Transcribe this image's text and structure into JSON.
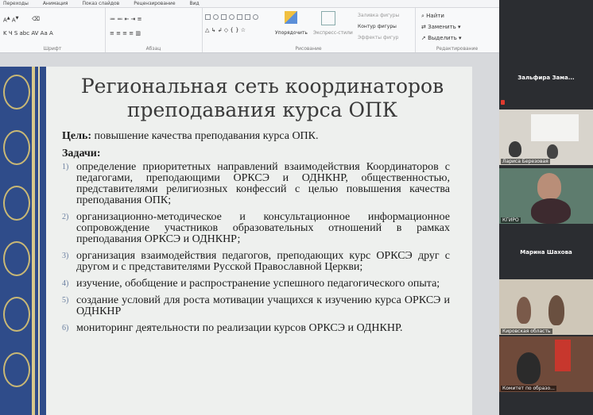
{
  "ribbon_tabs": [
    "Переходы",
    "Анимация",
    "Показ слайдов",
    "Рецензирование",
    "Вид"
  ],
  "ribbon": {
    "group_font": "Шрифт",
    "group_paragraph": "Абзац",
    "group_drawing": "Рисование",
    "group_editing": "Редактирование",
    "arrange": "Упорядочить",
    "express_styles": "Экспресс-стили",
    "shape_fill": "Заливка фигуры",
    "shape_outline": "Контур фигуры",
    "shape_effects": "Эффекты фигур",
    "find": "Найти",
    "replace": "Заменить",
    "select": "Выделить"
  },
  "slide": {
    "title_line1": "Региональная сеть координаторов",
    "title_line2": "преподавания курса ОПК",
    "goal_label": "Цель:",
    "goal_text": " повышение качества преподавания курса ОПК.",
    "tasks_label": "Задачи:",
    "tasks": [
      {
        "num": "1)",
        "text": "определение приоритетных направлений взаимодействия Координаторов с педагогами, преподающими ОРКСЭ и ОДНКНР, общественностью, представителями религиозных конфессий с целью повышения качества преподавания ОПК;"
      },
      {
        "num": "2)",
        "text": "организационно-методическое и консультационное информационное сопровождение участников образовательных отношений в рамках преподавания ОРКСЭ и ОДНКНР;"
      },
      {
        "num": "3)",
        "text": "организация взаимодействия педагогов, преподающих курс ОРКСЭ друг с другом и с представителями Русской Православной Церкви;"
      },
      {
        "num": "4)",
        "text": "изучение, обобщение и распространение успешного педагогического опыта;"
      },
      {
        "num": "5)",
        "text": "создание условий для роста мотивации учащихся к изучению курса ОРКСЭ и ОДНКНР"
      },
      {
        "num": "6)",
        "text": "мониторинг деятельности по реализации курсов ОРКСЭ и ОДНКНР."
      }
    ]
  },
  "participants": {
    "p1": "Зальфира Зама...",
    "p2": "Лариса Березовая",
    "p3": "КГИРО",
    "p4": "Марина Шахова",
    "p5": "Кировская область",
    "p6": "Комитет по образо..."
  },
  "colors": {
    "ornament": "#2f4c8a",
    "gold": "#d9c98a",
    "panel": "#2b2d31"
  }
}
